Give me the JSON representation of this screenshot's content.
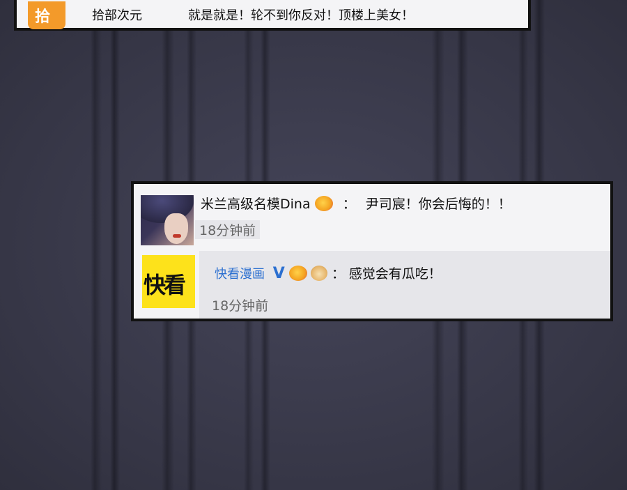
{
  "top_comment": {
    "icon_char": "拾",
    "username": "拾部次元",
    "message": "就是就是！轮不到你反对！顶楼上美女！"
  },
  "comment": {
    "username": "米兰高级名模Dina",
    "separator": "：",
    "message": "尹司宸！你会后悔的！！",
    "time": "18分钟前"
  },
  "reply": {
    "logo_text": "快看",
    "username": "快看漫画",
    "verified_mark": "V",
    "separator": "：",
    "message": "感觉会有瓜吃！",
    "time": "18分钟前"
  },
  "colors": {
    "link_blue": "#2b6fd0",
    "logo_yellow": "#fde21b",
    "icon_orange": "#f39a2a"
  }
}
